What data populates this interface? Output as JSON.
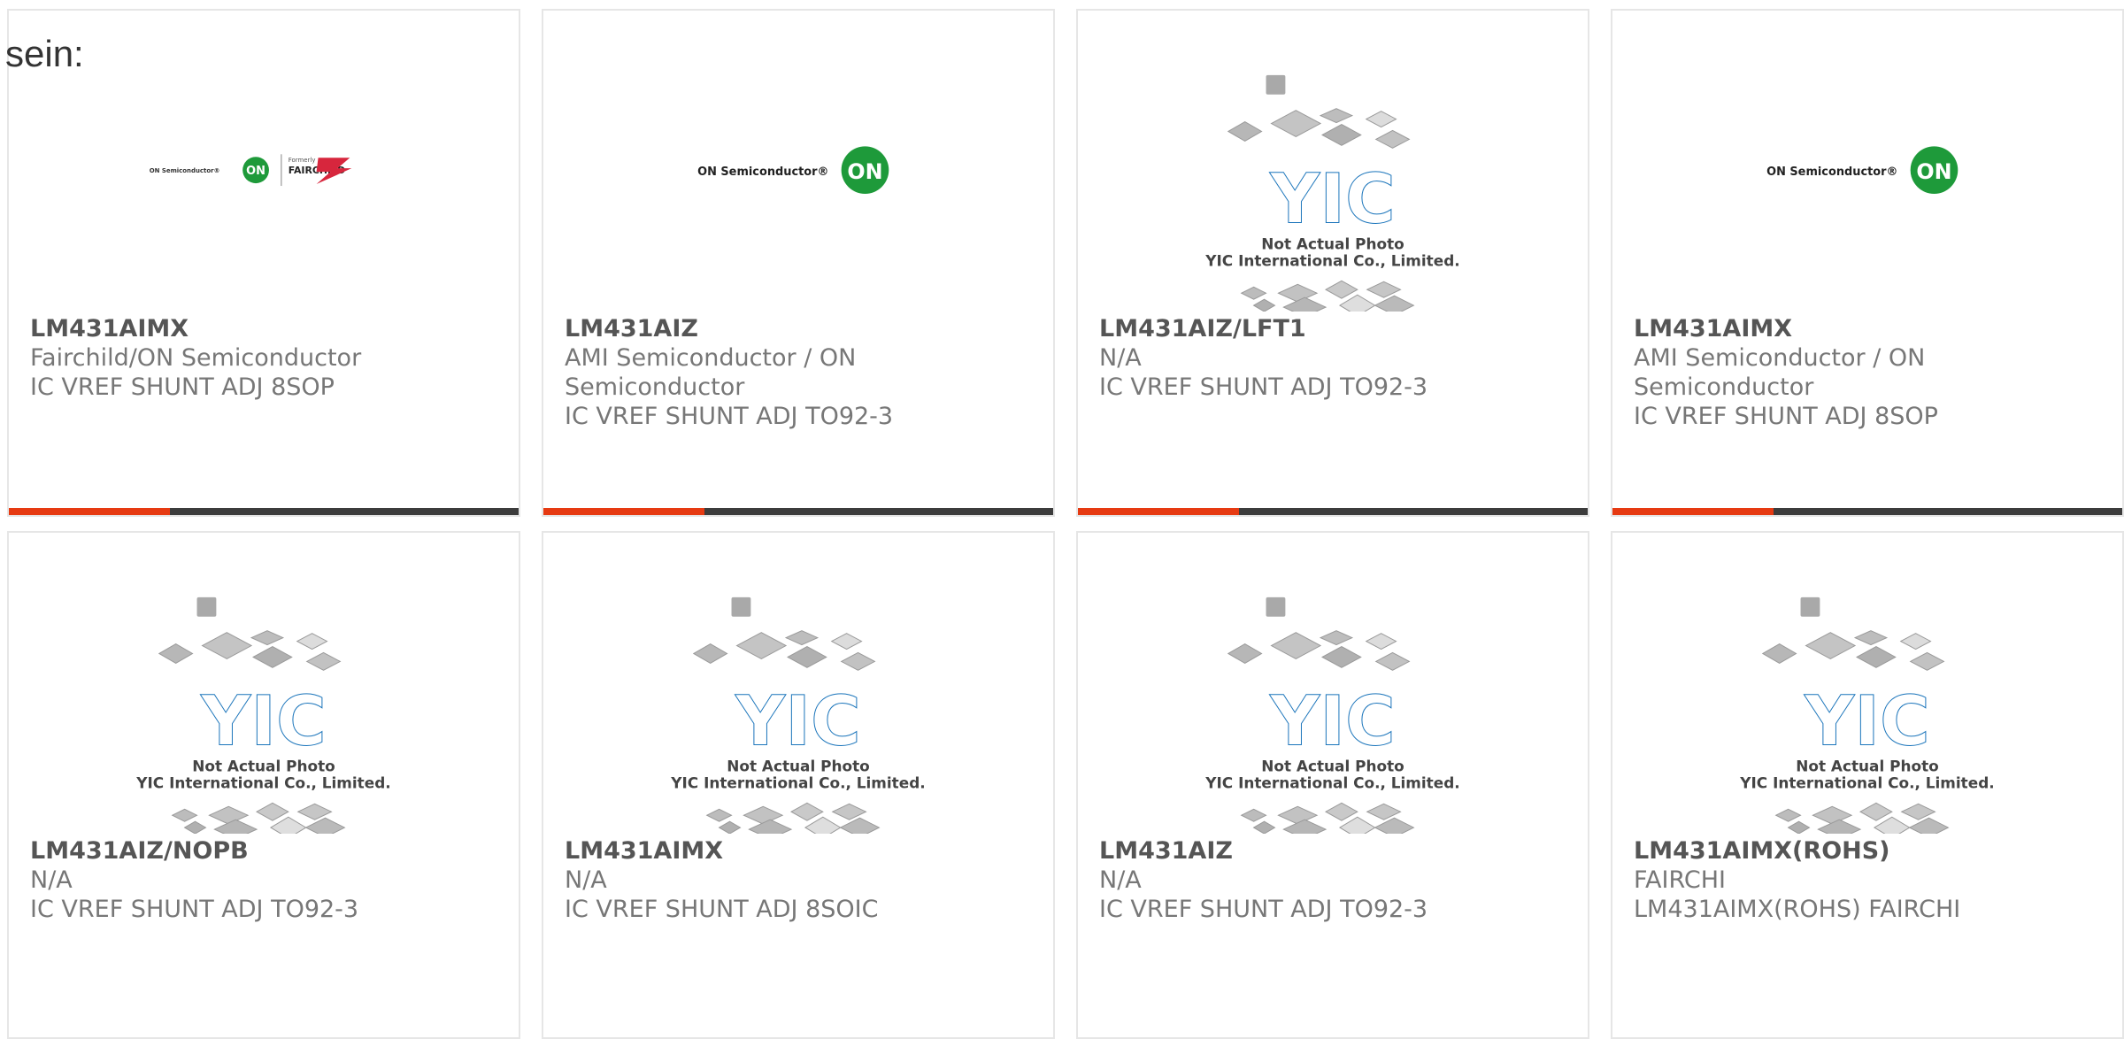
{
  "heading_fragment": "sein:",
  "colors": {
    "accent": "#e63a12",
    "bar": "#3c3c3c",
    "border": "#e6e6e6",
    "on_green": "#1e9a3a",
    "yic_blue": "#1b75bb",
    "fairchild_red": "#d7263d"
  },
  "image_texts": {
    "yic_logo": "YIC",
    "not_actual": "Not Actual Photo",
    "yic_company": "YIC International Co., Limited.",
    "on_semi": "ON Semiconductor®",
    "on_badge": "ON",
    "formerly": "Formerly",
    "fairchild": "FAIRCHILD"
  },
  "products": [
    {
      "part": "LM431AIMX",
      "manufacturer": "Fairchild/ON Semiconductor",
      "description": "IC VREF SHUNT ADJ 8SOP",
      "image": "fairchild-on-logo",
      "accent_bar": true
    },
    {
      "part": "LM431AIZ",
      "manufacturer": "AMI Semiconductor / ON Semiconductor",
      "description": "IC VREF SHUNT ADJ TO92-3",
      "image": "on-semi-logo",
      "accent_bar": true
    },
    {
      "part": "LM431AIZ/LFT1",
      "manufacturer": "N/A",
      "description": "IC VREF SHUNT ADJ TO92-3",
      "image": "yic-placeholder",
      "accent_bar": true
    },
    {
      "part": "LM431AIMX",
      "manufacturer": "AMI Semiconductor / ON Semiconductor",
      "description": "IC VREF SHUNT ADJ 8SOP",
      "image": "on-semi-logo",
      "accent_bar": true
    },
    {
      "part": "LM431AIZ/NOPB",
      "manufacturer": "N/A",
      "description": "IC VREF SHUNT ADJ TO92-3",
      "image": "yic-placeholder",
      "accent_bar": false
    },
    {
      "part": "LM431AIMX",
      "manufacturer": "N/A",
      "description": "IC VREF SHUNT ADJ 8SOIC",
      "image": "yic-placeholder",
      "accent_bar": false
    },
    {
      "part": "LM431AIZ",
      "manufacturer": "N/A",
      "description": "IC VREF SHUNT ADJ TO92-3",
      "image": "yic-placeholder",
      "accent_bar": false
    },
    {
      "part": "LM431AIMX(ROHS)",
      "manufacturer": "FAIRCHI",
      "description": "LM431AIMX(ROHS) FAIRCHI",
      "image": "yic-placeholder",
      "accent_bar": false
    }
  ]
}
